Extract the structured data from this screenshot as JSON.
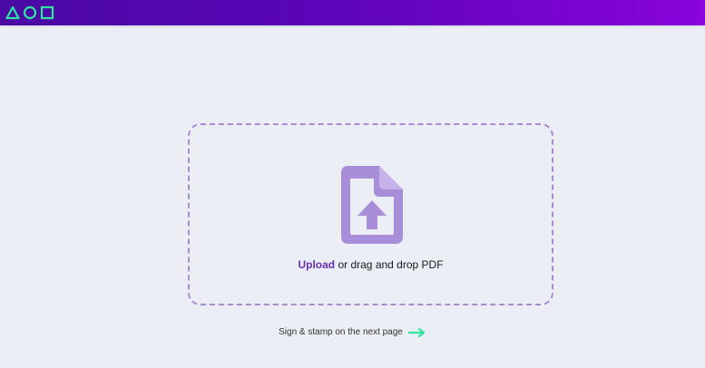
{
  "header": {
    "logo_icons": [
      "triangle-icon",
      "circle-icon",
      "square-icon"
    ],
    "accent_color": "#2ee6a0"
  },
  "dropzone": {
    "upload_label": "Upload",
    "rest_label": " or drag and drop PDF",
    "icon": "file-upload-icon"
  },
  "hint": {
    "text": "Sign & stamp on the next page",
    "icon": "arrow-right-icon"
  }
}
